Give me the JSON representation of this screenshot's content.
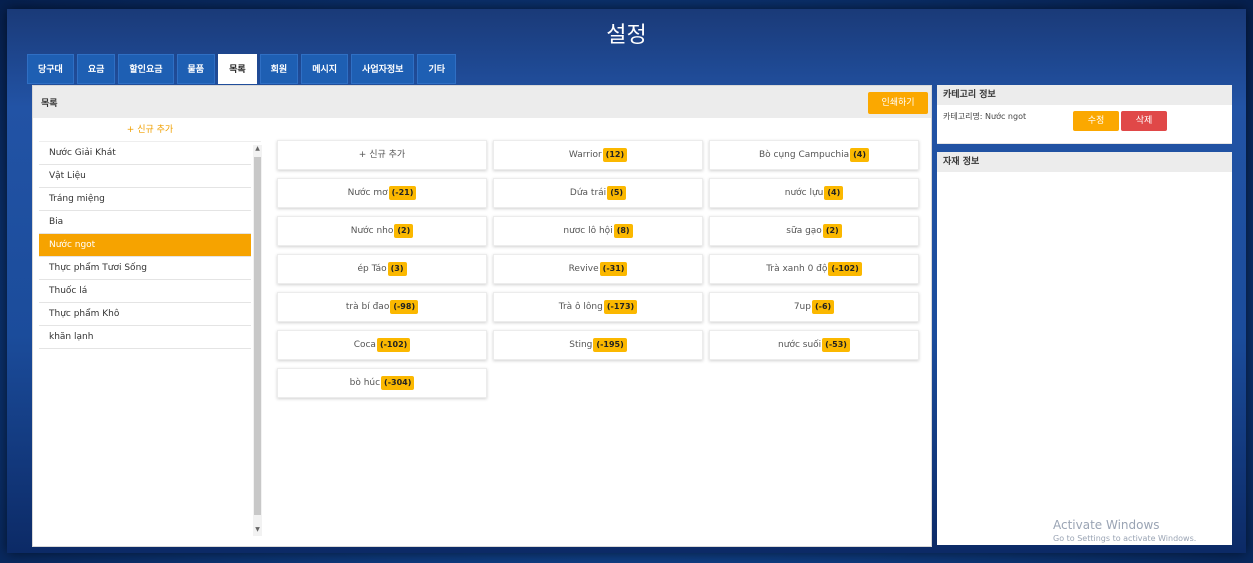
{
  "window": {
    "title": "설정"
  },
  "tabs": [
    {
      "label": "당구대"
    },
    {
      "label": "요금"
    },
    {
      "label": "할인요금"
    },
    {
      "label": "물품"
    },
    {
      "label": "목록",
      "active": true
    },
    {
      "label": "회원"
    },
    {
      "label": "메시지"
    },
    {
      "label": "사업자정보"
    },
    {
      "label": "기타"
    }
  ],
  "panel": {
    "title": "목록",
    "print_label": "인쇄하기"
  },
  "categories": {
    "add_label": "+ 신규 추가",
    "items": [
      {
        "label": "Nước Giải Khát"
      },
      {
        "label": "Vật Liệu"
      },
      {
        "label": "Tráng miệng"
      },
      {
        "label": "Bia"
      },
      {
        "label": "Nước ngot",
        "active": true
      },
      {
        "label": "Thực phẩm Tươi Sống"
      },
      {
        "label": "Thuốc lá"
      },
      {
        "label": "Thực phẩm Khô"
      },
      {
        "label": "khăn lạnh"
      }
    ]
  },
  "items": {
    "add_label": "+ 신규 추가",
    "list": [
      {
        "name": "Warrior",
        "count": "(12)"
      },
      {
        "name": "Bò cụng Campuchia",
        "count": "(4)"
      },
      {
        "name": "Nước mơ",
        "count": "(-21)"
      },
      {
        "name": "Dứa trái",
        "count": "(5)"
      },
      {
        "name": "nước lựu",
        "count": "(4)"
      },
      {
        "name": "Nước nho",
        "count": "(2)"
      },
      {
        "name": "nươc lô hội",
        "count": "(8)"
      },
      {
        "name": "sữa gạo",
        "count": "(2)"
      },
      {
        "name": "ép Táo",
        "count": "(3)"
      },
      {
        "name": "Revive",
        "count": "(-31)"
      },
      {
        "name": "Trà xanh 0 độ",
        "count": "(-102)"
      },
      {
        "name": "trà bí đao",
        "count": "(-98)"
      },
      {
        "name": "Trà ô lông",
        "count": "(-173)"
      },
      {
        "name": "7up",
        "count": "(-6)"
      },
      {
        "name": "Coca",
        "count": "(-102)"
      },
      {
        "name": "Sting",
        "count": "(-195)"
      },
      {
        "name": "nước suối",
        "count": "(-53)"
      },
      {
        "name": "bò húc",
        "count": "(-304)"
      }
    ]
  },
  "category_info": {
    "title": "카테고리 정보",
    "label": "카테고리명: Nước ngot",
    "edit_label": "수정",
    "delete_label": "삭제"
  },
  "detail_info": {
    "title": "자재 정보"
  },
  "watermark": {
    "line1": "Activate Windows",
    "line2": "Go to Settings to activate Windows."
  },
  "colors": {
    "accent": "#fba800",
    "danger": "#e04848",
    "tab_bg": "#1e5fb3"
  }
}
